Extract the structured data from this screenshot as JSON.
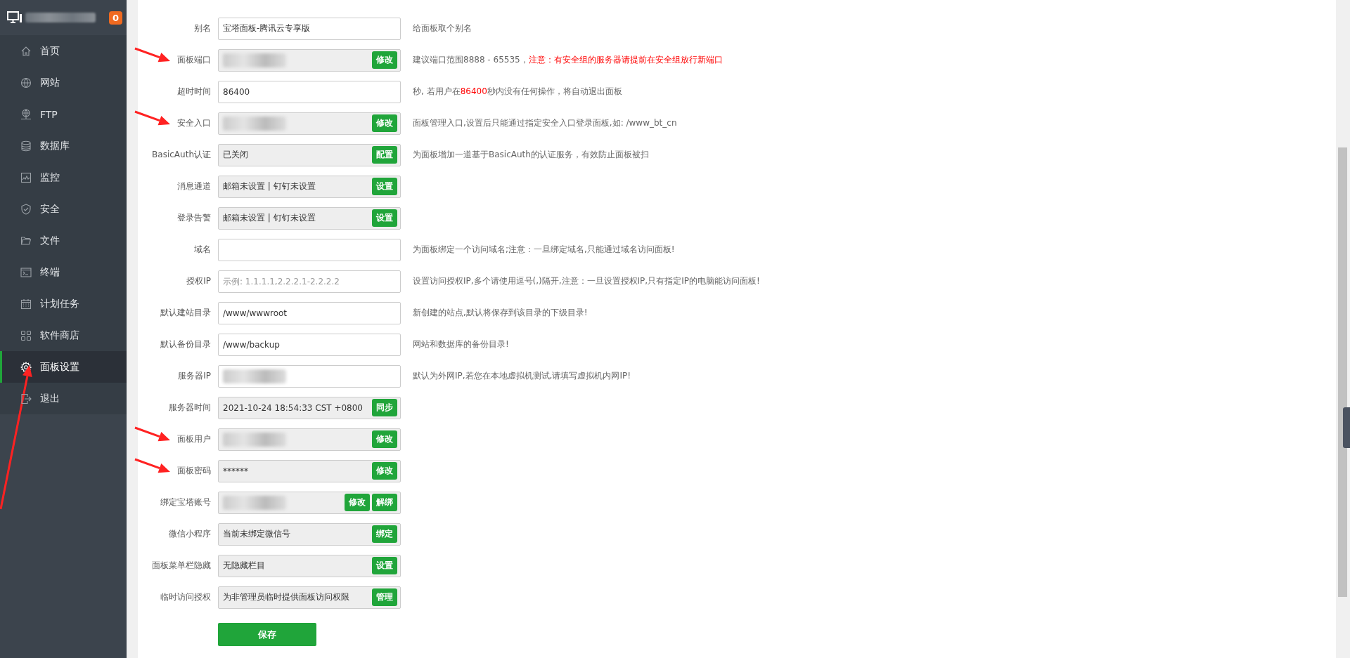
{
  "sidebar": {
    "header": {
      "host_redacted": true,
      "badge": "0"
    },
    "items": [
      {
        "label": "首页",
        "selected": false,
        "annotated": false
      },
      {
        "label": "网站",
        "selected": false,
        "annotated": false
      },
      {
        "label": "FTP",
        "selected": false,
        "annotated": false
      },
      {
        "label": "数据库",
        "selected": false,
        "annotated": false
      },
      {
        "label": "监控",
        "selected": false,
        "annotated": false
      },
      {
        "label": "安全",
        "selected": false,
        "annotated": false
      },
      {
        "label": "文件",
        "selected": false,
        "annotated": false
      },
      {
        "label": "终端",
        "selected": false,
        "annotated": false
      },
      {
        "label": "计划任务",
        "selected": false,
        "annotated": false
      },
      {
        "label": "软件商店",
        "selected": false,
        "annotated": false
      },
      {
        "label": "面板设置",
        "selected": true,
        "annotated": true
      },
      {
        "label": "退出",
        "selected": false,
        "annotated": false
      }
    ]
  },
  "form": {
    "rows": [
      {
        "label": "别名",
        "annotated": false,
        "field": {
          "kind": "input",
          "value": "宝塔面板-腾讯云专享版"
        },
        "buttons": [],
        "note": [
          {
            "text": "给面板取个别名",
            "warn": false
          }
        ]
      },
      {
        "label": "面板端口",
        "annotated": true,
        "field": {
          "kind": "readonly",
          "redacted": true
        },
        "buttons": [
          "修改"
        ],
        "note": [
          {
            "text": "建议端口范围8888 - 65535，",
            "warn": false
          },
          {
            "text": "注意：有安全组的服务器请提前在安全组放行新端口",
            "warn": true
          }
        ]
      },
      {
        "label": "超时时间",
        "annotated": false,
        "field": {
          "kind": "input",
          "value": "86400"
        },
        "buttons": [],
        "note": [
          {
            "text": "秒, 若用户在",
            "warn": false
          },
          {
            "text": "86400",
            "warn": true
          },
          {
            "text": "秒内没有任何操作，将自动退出面板",
            "warn": false
          }
        ]
      },
      {
        "label": "安全入口",
        "annotated": true,
        "field": {
          "kind": "readonly",
          "redacted": true
        },
        "buttons": [
          "修改"
        ],
        "note": [
          {
            "text": "面板管理入口,设置后只能通过指定安全入口登录面板,如: /www_bt_cn",
            "warn": false
          }
        ]
      },
      {
        "label": "BasicAuth认证",
        "annotated": false,
        "field": {
          "kind": "readonly",
          "value": "已关闭"
        },
        "buttons": [
          "配置"
        ],
        "note": [
          {
            "text": "为面板增加一道基于BasicAuth的认证服务，有效防止面板被扫",
            "warn": false
          }
        ]
      },
      {
        "label": "消息通道",
        "annotated": false,
        "field": {
          "kind": "readonly",
          "value": "邮箱未设置 | 钉钉未设置"
        },
        "buttons": [
          "设置"
        ],
        "note": []
      },
      {
        "label": "登录告警",
        "annotated": false,
        "field": {
          "kind": "readonly",
          "value": "邮箱未设置 | 钉钉未设置"
        },
        "buttons": [
          "设置"
        ],
        "note": []
      },
      {
        "label": "域名",
        "annotated": false,
        "field": {
          "kind": "input"
        },
        "buttons": [],
        "note": [
          {
            "text": "为面板绑定一个访问域名;注意：一旦绑定域名,只能通过域名访问面板!",
            "warn": false
          }
        ]
      },
      {
        "label": "授权IP",
        "annotated": false,
        "field": {
          "kind": "input",
          "placeholder": "示例: 1.1.1.1,2.2.2.1-2.2.2.2"
        },
        "buttons": [],
        "note": [
          {
            "text": "设置访问授权IP,多个请使用逗号(,)隔开,注意：一旦设置授权IP,只有指定IP的电脑能访问面板!",
            "warn": false
          }
        ]
      },
      {
        "label": "默认建站目录",
        "annotated": false,
        "field": {
          "kind": "input",
          "value": "/www/wwwroot"
        },
        "buttons": [],
        "note": [
          {
            "text": "新创建的站点,默认将保存到该目录的下级目录!",
            "warn": false
          }
        ]
      },
      {
        "label": "默认备份目录",
        "annotated": false,
        "field": {
          "kind": "input",
          "value": "/www/backup"
        },
        "buttons": [],
        "note": [
          {
            "text": "网站和数据库的备份目录!",
            "warn": false
          }
        ]
      },
      {
        "label": "服务器IP",
        "annotated": false,
        "field": {
          "kind": "input",
          "redacted": true
        },
        "buttons": [],
        "note": [
          {
            "text": "默认为外网IP,若您在本地虚拟机测试,请填写虚拟机内网IP!",
            "warn": false
          }
        ]
      },
      {
        "label": "服务器时间",
        "annotated": false,
        "field": {
          "kind": "readonly",
          "value": "2021-10-24 18:54:33 CST +0800"
        },
        "buttons": [
          "同步"
        ],
        "note": []
      },
      {
        "label": "面板用户",
        "annotated": true,
        "field": {
          "kind": "readonly",
          "redacted": true
        },
        "buttons": [
          "修改"
        ],
        "note": []
      },
      {
        "label": "面板密码",
        "annotated": true,
        "field": {
          "kind": "readonly",
          "value": "******"
        },
        "buttons": [
          "修改"
        ],
        "note": []
      },
      {
        "label": "绑定宝塔账号",
        "annotated": false,
        "field": {
          "kind": "readonly",
          "redacted": true
        },
        "buttons": [
          "修改",
          "解绑"
        ],
        "note": []
      },
      {
        "label": "微信小程序",
        "annotated": false,
        "field": {
          "kind": "readonly",
          "value": "当前未绑定微信号"
        },
        "buttons": [
          "绑定"
        ],
        "note": []
      },
      {
        "label": "面板菜单栏隐藏",
        "annotated": false,
        "field": {
          "kind": "readonly",
          "value": "无隐藏栏目"
        },
        "buttons": [
          "设置"
        ],
        "note": []
      },
      {
        "label": "临时访问授权",
        "annotated": false,
        "field": {
          "kind": "readonly",
          "value": "为非管理员临时提供面板访问权限"
        },
        "buttons": [
          "管理"
        ],
        "note": []
      }
    ],
    "save_button": "保存"
  }
}
